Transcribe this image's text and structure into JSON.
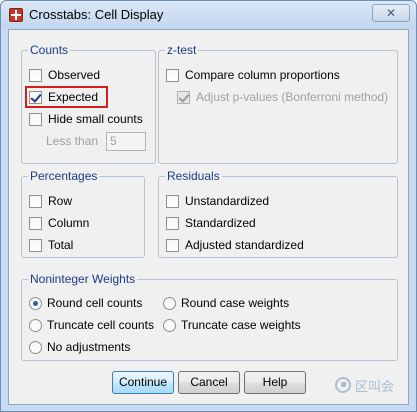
{
  "window": {
    "title": "Crosstabs: Cell Display",
    "close_label": "✕"
  },
  "counts": {
    "legend": "Counts",
    "observed": {
      "label": "Observed",
      "checked": false
    },
    "expected": {
      "label": "Expected",
      "checked": true
    },
    "hide_small": {
      "label": "Hide small counts",
      "checked": false
    },
    "less_than_label": "Less than",
    "less_than_value": "5"
  },
  "ztest": {
    "legend": "z-test",
    "compare": {
      "label": "Compare column proportions",
      "checked": false
    },
    "adjust": {
      "label": "Adjust p-values (Bonferroni method)",
      "checked": true,
      "disabled": true
    }
  },
  "percentages": {
    "legend": "Percentages",
    "row": "Row",
    "column": "Column",
    "total": "Total"
  },
  "residuals": {
    "legend": "Residuals",
    "unstandardized": "Unstandardized",
    "standardized": "Standardized",
    "adjusted": "Adjusted standardized"
  },
  "weights": {
    "legend": "Noninteger Weights",
    "round_cell": "Round cell counts",
    "round_case": "Round case weights",
    "truncate_cell": "Truncate cell counts",
    "truncate_case": "Truncate case weights",
    "no_adjust": "No adjustments",
    "selected": "Round cell counts"
  },
  "buttons": {
    "continue": "Continue",
    "cancel": "Cancel",
    "help": "Help"
  },
  "watermark": {
    "text": "区叫会"
  },
  "colors": {
    "group_label": "#1c3a8a",
    "highlight": "#d21f1f",
    "window_frame": "#c9dbf0"
  }
}
